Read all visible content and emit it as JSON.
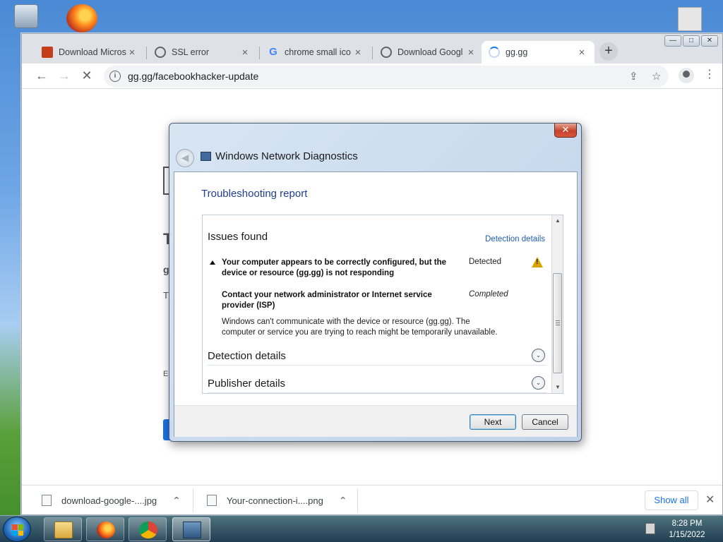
{
  "browser": {
    "tabs": [
      {
        "label": "Download Micros",
        "icon": "powerpoint-icon",
        "close": "×"
      },
      {
        "label": "SSL error",
        "icon": "globe-icon",
        "close": "×"
      },
      {
        "label": "chrome small ico",
        "icon": "google-icon",
        "close": "×"
      },
      {
        "label": "Download Googl",
        "icon": "globe-icon",
        "close": "×"
      },
      {
        "label": "gg.gg",
        "icon": "loading-spinner-icon",
        "close": "×",
        "active": true
      }
    ],
    "new_tab": "+",
    "window_buttons": {
      "minimize": "—",
      "restore": "□",
      "close": "✕"
    },
    "nav": {
      "back": "←",
      "forward": "→",
      "stop": "✕"
    },
    "address": "gg.gg/facebookhacker-update",
    "address_info": "i",
    "kebab": "⋮",
    "share_icon": "⇪",
    "star_icon": "☆"
  },
  "page_ghost": {
    "t": "T",
    "g": "g",
    "t2": "T",
    "e": "E"
  },
  "dialog": {
    "close": "✕",
    "back": "◀",
    "title": "Windows Network Diagnostics",
    "report_title": "Troubleshooting report",
    "issues_heading": "Issues found",
    "detection_link": "Detection details",
    "issue_line1": "Your computer appears to be correctly configured, but the",
    "issue_line2": "device or resource (gg.gg) is not responding",
    "issue_status": "Detected",
    "warning": "!",
    "fix_line1": "Contact your network administrator or Internet service",
    "fix_line2": "provider (ISP)",
    "fix_status": "Completed",
    "desc_line1": "Windows can't communicate with the device or resource (gg.gg). The",
    "desc_line2": "computer or service you are trying to reach might be temporarily unavailable.",
    "detection_heading": "Detection details",
    "publisher_heading": "Publisher details",
    "expand": "⌄",
    "next_label": "Next",
    "cancel_label": "Cancel",
    "scroll_up": "▲",
    "scroll_down": "▼"
  },
  "downloads": {
    "items": [
      {
        "name": "download-google-....jpg",
        "chevron": "⌃"
      },
      {
        "name": "Your-connection-i....png",
        "chevron": "⌃"
      }
    ],
    "show_all": "Show all",
    "close": "✕"
  },
  "taskbar": {
    "time": "8:28 PM",
    "date": "1/15/2022",
    "apps": [
      "explorer-icon",
      "firefox-icon",
      "chrome-icon",
      "network-diagnostics-icon"
    ]
  },
  "colors": {
    "accent_link": "#1f5cb0",
    "report_title": "#1e3f8f",
    "chrome_blue": "#1a73e8",
    "warning_yellow": "#d9a400"
  }
}
